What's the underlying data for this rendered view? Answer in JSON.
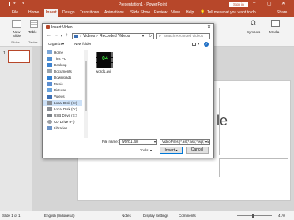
{
  "app": {
    "window_title": "Presentation1 - PowerPoint",
    "sign_in": "Sign in",
    "tabs": [
      "File",
      "Home",
      "Insert",
      "Design",
      "Transitions",
      "Animations",
      "Slide Show",
      "Review",
      "View",
      "Help"
    ],
    "active_tab": "Insert",
    "tell_me": "Tell me what you want to do",
    "share": "Share"
  },
  "ribbon": {
    "new_slide_label": "New Slide",
    "table_label": "Table",
    "slides_group": "Slides",
    "tables_group": "Tables",
    "symbols_label": "Symbols",
    "media_label": "Media"
  },
  "thumbnail": {
    "number": "1"
  },
  "slide": {
    "placeholder_fragment": "le"
  },
  "dialog": {
    "title": "Insert Video",
    "breadcrumb": [
      "Videos",
      "Recorded Videos"
    ],
    "search_placeholder": "Search Recorded Videos",
    "toolbar": {
      "organize": "Organize",
      "new_folder": "New folder"
    },
    "nav_items": [
      {
        "label": "Home",
        "icon": "home-icon"
      },
      {
        "label": "This PC",
        "icon": "computer-icon"
      },
      {
        "label": "Desktop",
        "icon": "desktop-folder-icon"
      },
      {
        "label": "Documents",
        "icon": "documents-folder-icon"
      },
      {
        "label": "Downloads",
        "icon": "downloads-folder-icon"
      },
      {
        "label": "Music",
        "icon": "music-folder-icon"
      },
      {
        "label": "Pictures",
        "icon": "pictures-folder-icon"
      },
      {
        "label": "Videos",
        "icon": "videos-folder-icon"
      },
      {
        "label": "Local Disk (C:)",
        "icon": "drive-icon"
      },
      {
        "label": "Local Disk (D:)",
        "icon": "drive-icon"
      },
      {
        "label": "USB Drive (E:)",
        "icon": "usb-drive-icon"
      },
      {
        "label": "CD Drive (F:)",
        "icon": "cd-drive-icon"
      },
      {
        "label": "Libraries",
        "icon": "libraries-icon"
      }
    ],
    "selected_nav": "Local Disk (C:)",
    "file_item": {
      "name": "word1.avi",
      "thumb_text": "04"
    },
    "file_name_label": "File name:",
    "file_name_value": "word1.avi",
    "file_type_value": "Video Files (*.asf;*.asx;*.wpl;*.w",
    "tools_label": "Tools",
    "insert_label": "Insert",
    "cancel_label": "Cancel"
  },
  "status": {
    "slide_info": "Slide 1 of 1",
    "language": "English (Indonesia)",
    "notes": "Notes",
    "display_settings": "Display Settings",
    "comments": "Comments",
    "zoom": "41%"
  },
  "colors": {
    "accent": "#b7472a",
    "selection": "#cde1f7",
    "primary_border": "#0078d7"
  }
}
